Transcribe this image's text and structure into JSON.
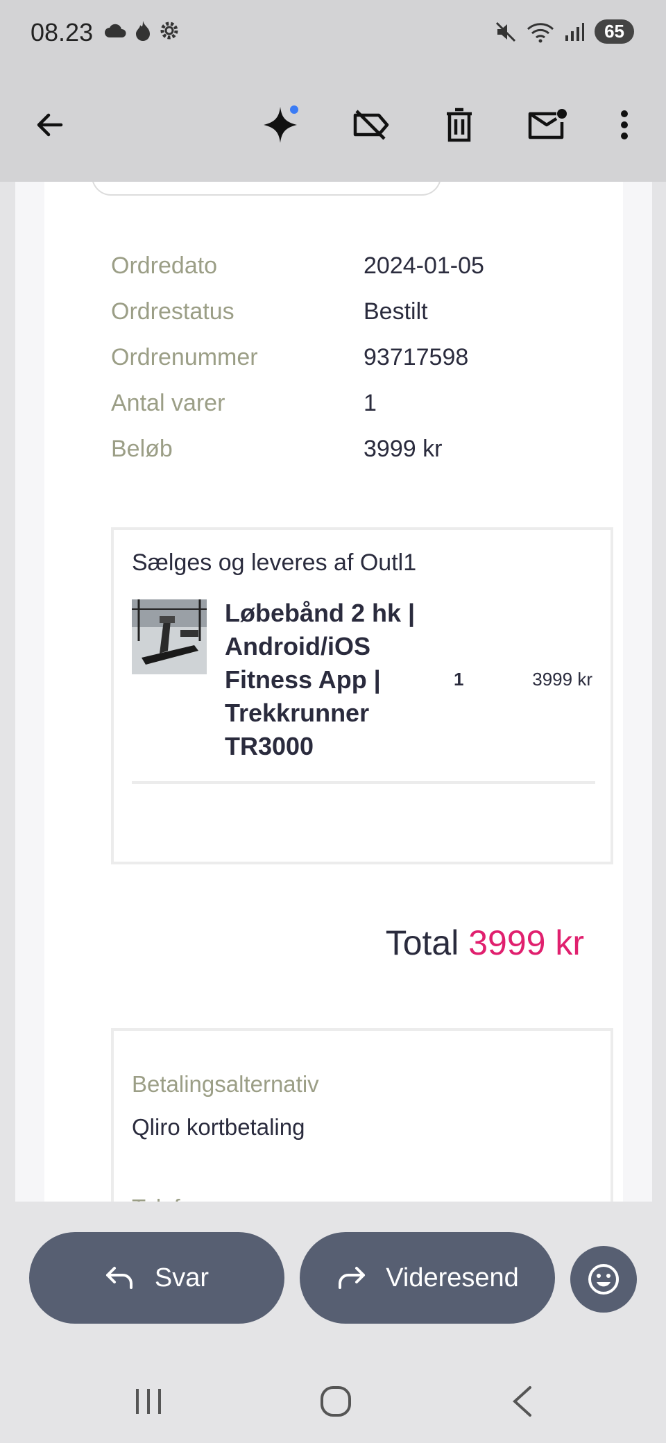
{
  "status_bar": {
    "time": "08.23",
    "battery": "65"
  },
  "order_info": [
    {
      "label": "Ordredato",
      "value": "2024-01-05"
    },
    {
      "label": "Ordrestatus",
      "value": "Bestilt"
    },
    {
      "label": "Ordrenummer",
      "value": "93717598"
    },
    {
      "label": "Antal varer",
      "value": "1"
    },
    {
      "label": "Beløb",
      "value": "3999 kr"
    }
  ],
  "seller": {
    "title": "Sælges og leveres af Outl1",
    "product_name": "Løbebånd 2 hk | Android/iOS Fitness App | Trekkrunner TR3000",
    "quantity": "1",
    "price": "3999 kr"
  },
  "total": {
    "label": "Total",
    "amount": "3999 kr"
  },
  "payment": {
    "label": "Betalingsalternativ",
    "value": "Qliro kortbetaling",
    "phone_label": "Telefonnummer"
  },
  "actions": {
    "reply": "Svar",
    "forward": "Videresend"
  },
  "colors": {
    "accent": "#e0206e",
    "button": "#575f72",
    "label": "#9b9e86"
  }
}
